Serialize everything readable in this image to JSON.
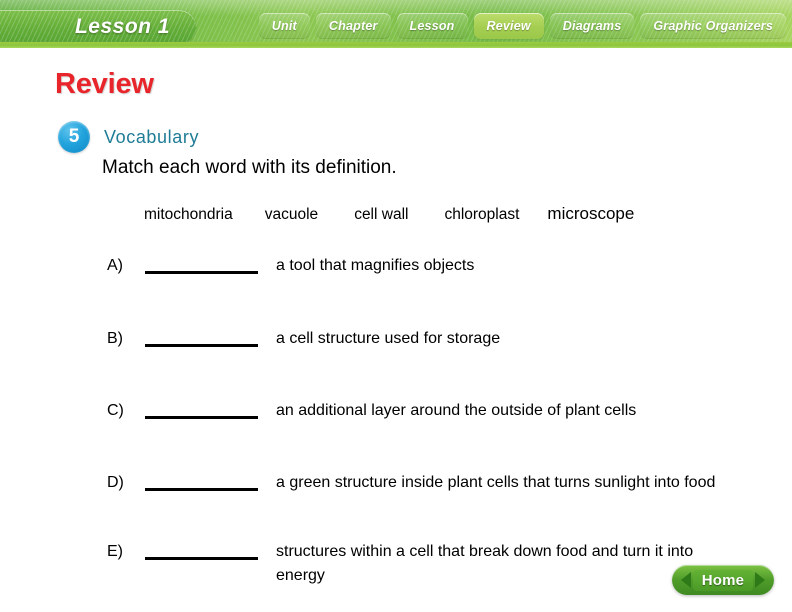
{
  "header": {
    "lesson_tab": "Lesson 1",
    "nav_tabs": [
      {
        "label": "Unit",
        "active": false
      },
      {
        "label": "Chapter",
        "active": false
      },
      {
        "label": "Lesson",
        "active": false
      },
      {
        "label": "Review",
        "active": true
      },
      {
        "label": "Diagrams",
        "active": false
      },
      {
        "label": "Graphic Organizers",
        "active": false
      }
    ],
    "accent_green": "#8cc63e",
    "active_tab_green": "#a5ce51"
  },
  "main": {
    "section_title": "Review",
    "section_title_color": "#e8252a",
    "badge_number": "5",
    "badge_color": "#23a4dd",
    "badge_label": "Vocabulary",
    "badge_label_color": "#1f7c96",
    "instruction": "Match each word with its definition.",
    "word_bank": [
      "mitochondria",
      "vacuole",
      "cell wall",
      "chloroplast",
      "microscope"
    ],
    "questions": [
      {
        "label": "A)",
        "answer": "",
        "definition": "a tool that magnifies objects"
      },
      {
        "label": "B)",
        "answer": "",
        "definition": "a cell structure used for storage"
      },
      {
        "label": "C)",
        "answer": "",
        "definition": "an additional layer around the outside of plant cells"
      },
      {
        "label": "D)",
        "answer": "",
        "definition": "a green structure inside plant cells that turns sunlight into food"
      },
      {
        "label": "E)",
        "answer": "",
        "definition": "structures within a cell that break down food and turn it into energy"
      }
    ]
  },
  "footer": {
    "home_label": "Home"
  }
}
